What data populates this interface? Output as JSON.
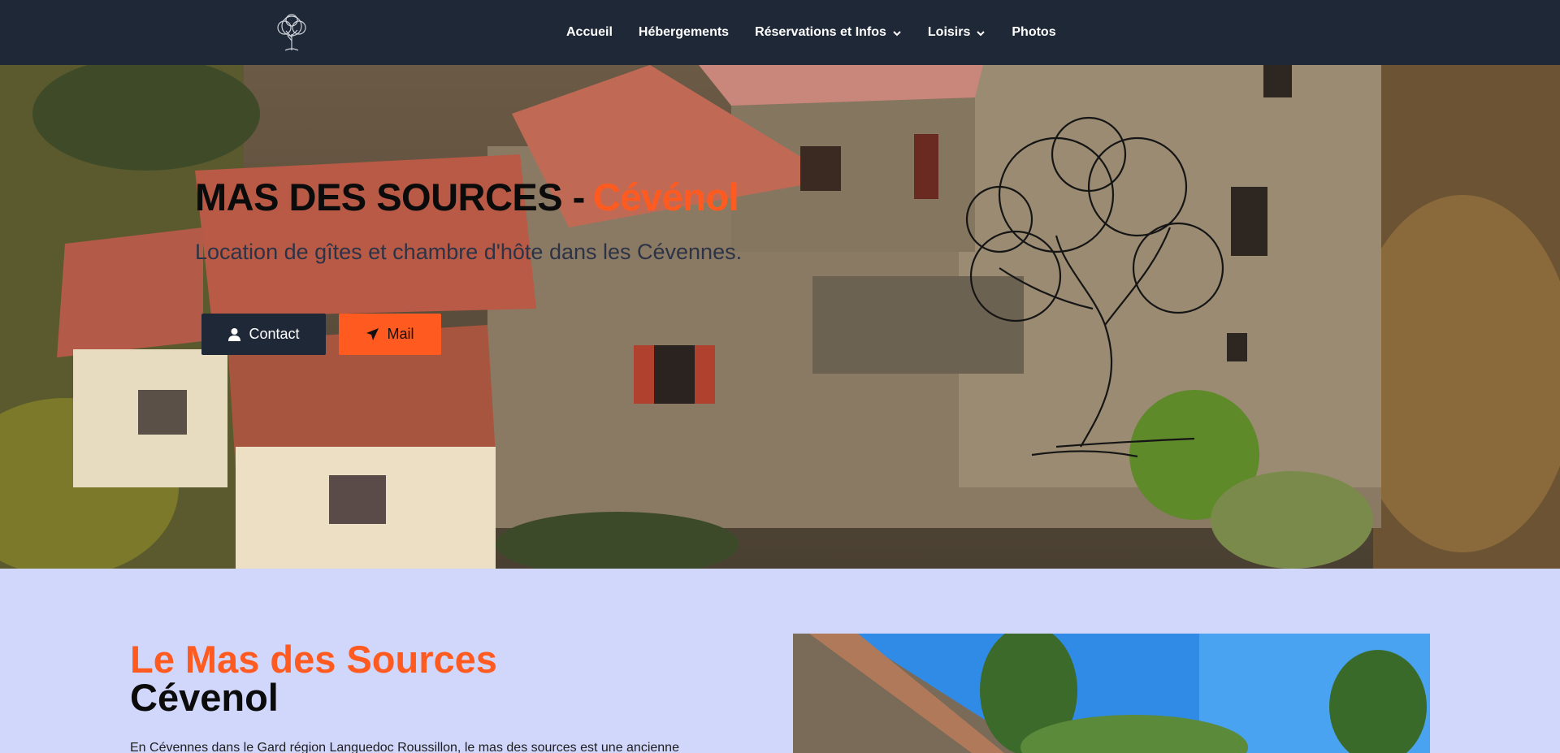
{
  "brand": {
    "logo_icon": "tree-icon"
  },
  "nav": {
    "items": [
      {
        "label": "Accueil",
        "dropdown": false
      },
      {
        "label": "Hébergements",
        "dropdown": false
      },
      {
        "label": "Réservations et Infos",
        "dropdown": true
      },
      {
        "label": "Loisirs",
        "dropdown": true
      },
      {
        "label": "Photos",
        "dropdown": false
      }
    ]
  },
  "hero": {
    "title_main": "MAS DES SOURCES -",
    "title_accent": "Cévénol",
    "subtitle": "Location de gîtes et chambre d'hôte dans les Cévennes.",
    "buttons": {
      "contact": {
        "label": "Contact",
        "icon": "user-icon"
      },
      "mail": {
        "label": "Mail",
        "icon": "paper-plane-icon"
      }
    }
  },
  "intro": {
    "title_line1": "Le Mas des Sources",
    "title_line2": "Cévenol",
    "text": "En Cévennes dans le Gard région Languedoc Roussillon, le mas des sources est une ancienne"
  },
  "colors": {
    "navbar": "#1f2837",
    "accent": "#ff5a1f",
    "section_bg": "#d1d6fb"
  }
}
